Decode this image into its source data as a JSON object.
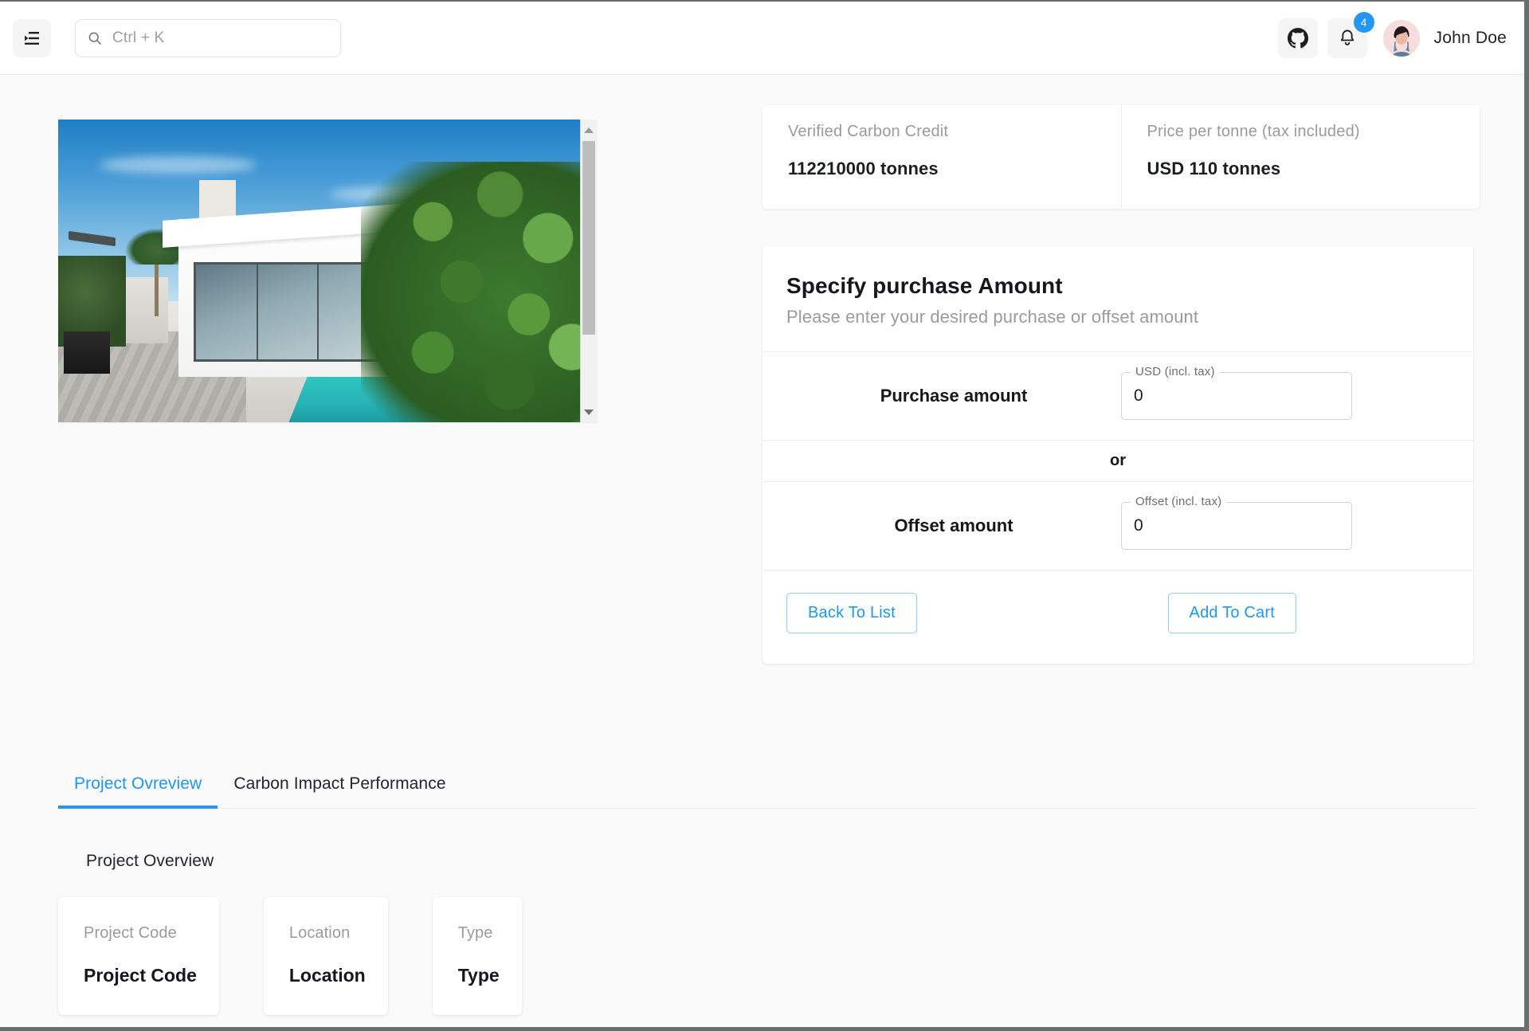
{
  "header": {
    "menu_icon": "menu-indent-icon",
    "search": {
      "icon": "search-icon",
      "placeholder": "Ctrl + K",
      "value": ""
    },
    "github_icon": "github-icon",
    "notifications": {
      "icon": "bell-icon",
      "badge_count": "4"
    },
    "avatar_name": "avatar",
    "user_name": "John Doe",
    "badge_color": "#2196f3"
  },
  "media": {
    "image_alt": "modern white villa with swimming pool and palm trees",
    "scrollbar": {
      "up_arrow": "triangle-up-icon",
      "down_arrow": "triangle-down-icon"
    }
  },
  "stats": [
    {
      "label": "Verified Carbon Credit",
      "value": "112210000 tonnes"
    },
    {
      "label": "Price per tonne (tax included)",
      "value": "USD 110 tonnes"
    }
  ],
  "purchase": {
    "title": "Specify purchase Amount",
    "subtitle": "Please enter your desired purchase or offset amount",
    "purchase_row": {
      "label": "Purchase amount",
      "field_legend": "USD (incl. tax)",
      "field_value": "0"
    },
    "separator": "or",
    "offset_row": {
      "label": "Offset amount",
      "field_legend": "Offset (incl. tax)",
      "field_value": "0"
    },
    "back_button": "Back To List",
    "cart_button": "Add To Cart",
    "accent_color": "#2196f3"
  },
  "tabs": [
    {
      "label": "Project Ovreview",
      "active": true
    },
    {
      "label": "Carbon Impact Performance",
      "active": false
    }
  ],
  "overview": {
    "section_title": "Project Overview",
    "cards": [
      {
        "label": "Project Code",
        "value": "Project Code"
      },
      {
        "label": "Location",
        "value": "Location"
      },
      {
        "label": "Type",
        "value": "Type"
      }
    ]
  }
}
